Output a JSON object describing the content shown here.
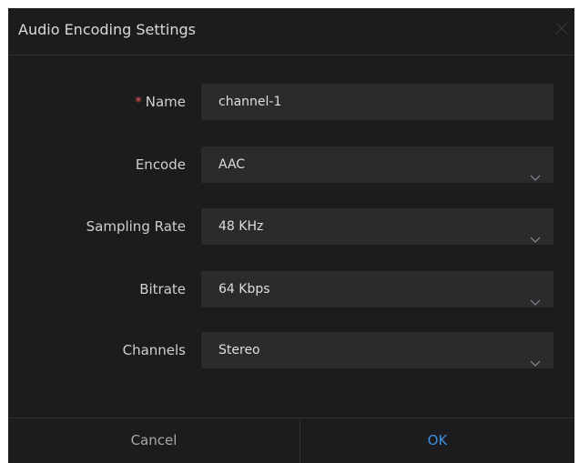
{
  "dialog": {
    "title": "Audio Encoding Settings",
    "close_icon": "close-icon"
  },
  "form": {
    "name": {
      "required_mark": "*",
      "label": "Name",
      "value": "channel-1"
    },
    "encode": {
      "label": "Encode",
      "value": "AAC",
      "icon": "chevron-down-icon"
    },
    "sampling_rate": {
      "label": "Sampling Rate",
      "value": "48 KHz",
      "icon": "chevron-down-icon"
    },
    "bitrate": {
      "label": "Bitrate",
      "value": "64 Kbps",
      "icon": "chevron-down-icon"
    },
    "channels": {
      "label": "Channels",
      "value": "Stereo",
      "icon": "chevron-down-icon"
    }
  },
  "footer": {
    "cancel_label": "Cancel",
    "ok_label": "OK"
  },
  "colors": {
    "background": "#1c1c1f",
    "field": "#2b2b2e",
    "accent": "#3d8fe0",
    "required": "#e05353"
  }
}
